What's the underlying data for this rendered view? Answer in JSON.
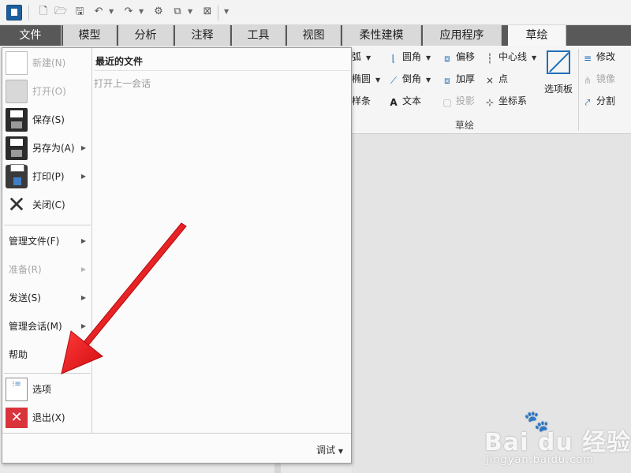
{
  "tabs": [
    "文件",
    "模型",
    "分析",
    "注释",
    "工具",
    "视图",
    "柔性建模",
    "应用程序",
    "草绘"
  ],
  "active_tab": "草绘",
  "ribbon": {
    "col1": [
      "弧",
      "椭圆",
      "样条"
    ],
    "col2": [
      "圆角",
      "倒角",
      "文本"
    ],
    "col3": [
      "偏移",
      "加厚",
      "投影"
    ],
    "col4": [
      "中心线",
      "点",
      "坐标系"
    ],
    "palette": "选项板",
    "col5": [
      "修改",
      "镜像",
      "分割"
    ],
    "group_label": "草绘"
  },
  "file_menu": {
    "items": {
      "new": "新建(N)",
      "open": "打开(O)",
      "save": "保存(S)",
      "save_as": "另存为(A)",
      "print": "打印(P)",
      "close": "关闭(C)",
      "manage_file": "管理文件(F)",
      "prepare": "准备(R)",
      "send": "发送(S)",
      "manage_session": "管理会话(M)",
      "help": "帮助",
      "options": "选项",
      "exit": "退出(X)"
    },
    "recent_title": "最近的文件",
    "open_last_session": "打开上一会话",
    "debug": "调试"
  },
  "watermark": {
    "logo": "Bai du 经验",
    "url": "jingyan.baidu.com"
  },
  "colors": {
    "arrow": "#e8181b",
    "file_tab": "#585858",
    "accent": "#1f6fb8",
    "exit_icon": "#d9333b"
  }
}
